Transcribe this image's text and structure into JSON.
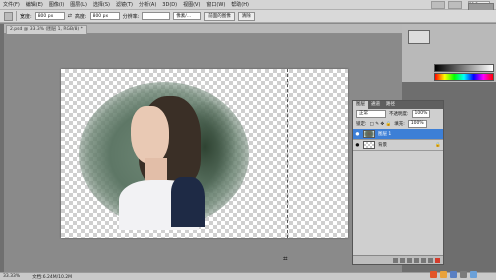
{
  "menubar": {
    "items": [
      "文件(F)",
      "编辑(E)",
      "图像(I)",
      "图层(L)",
      "选择(S)",
      "滤镜(T)",
      "分析(A)",
      "3D(D)",
      "视图(V)",
      "窗口(W)",
      "帮助(H)"
    ],
    "zoom": "33.3"
  },
  "options": {
    "width_label": "宽度:",
    "width_value": "800 px",
    "height_label": "高度:",
    "height_value": "800 px",
    "resolution_label": "分辨率:",
    "unit_value": "像素/...",
    "front_image_btn": "前面的图像",
    "clear_btn": "清除"
  },
  "doc": {
    "tab_title": "2.psd @ 33.3% (图层 1, RGB/8) *"
  },
  "layers_panel": {
    "tabs": [
      "图层",
      "通道",
      "路径"
    ],
    "blend_mode": "正常",
    "opacity_label": "不透明度:",
    "opacity_value": "100%",
    "lock_label": "锁定:",
    "fill_label": "填充:",
    "fill_value": "100%",
    "layers": [
      {
        "name": "图层 1",
        "selected": true
      },
      {
        "name": "背景",
        "selected": false
      }
    ]
  },
  "status": {
    "zoom": "33.33%",
    "doc_size": "文档:6.24M/10.2M"
  },
  "colors": {
    "selection": "#3d7fd6",
    "canvas_bg": "#8a8a8a"
  }
}
